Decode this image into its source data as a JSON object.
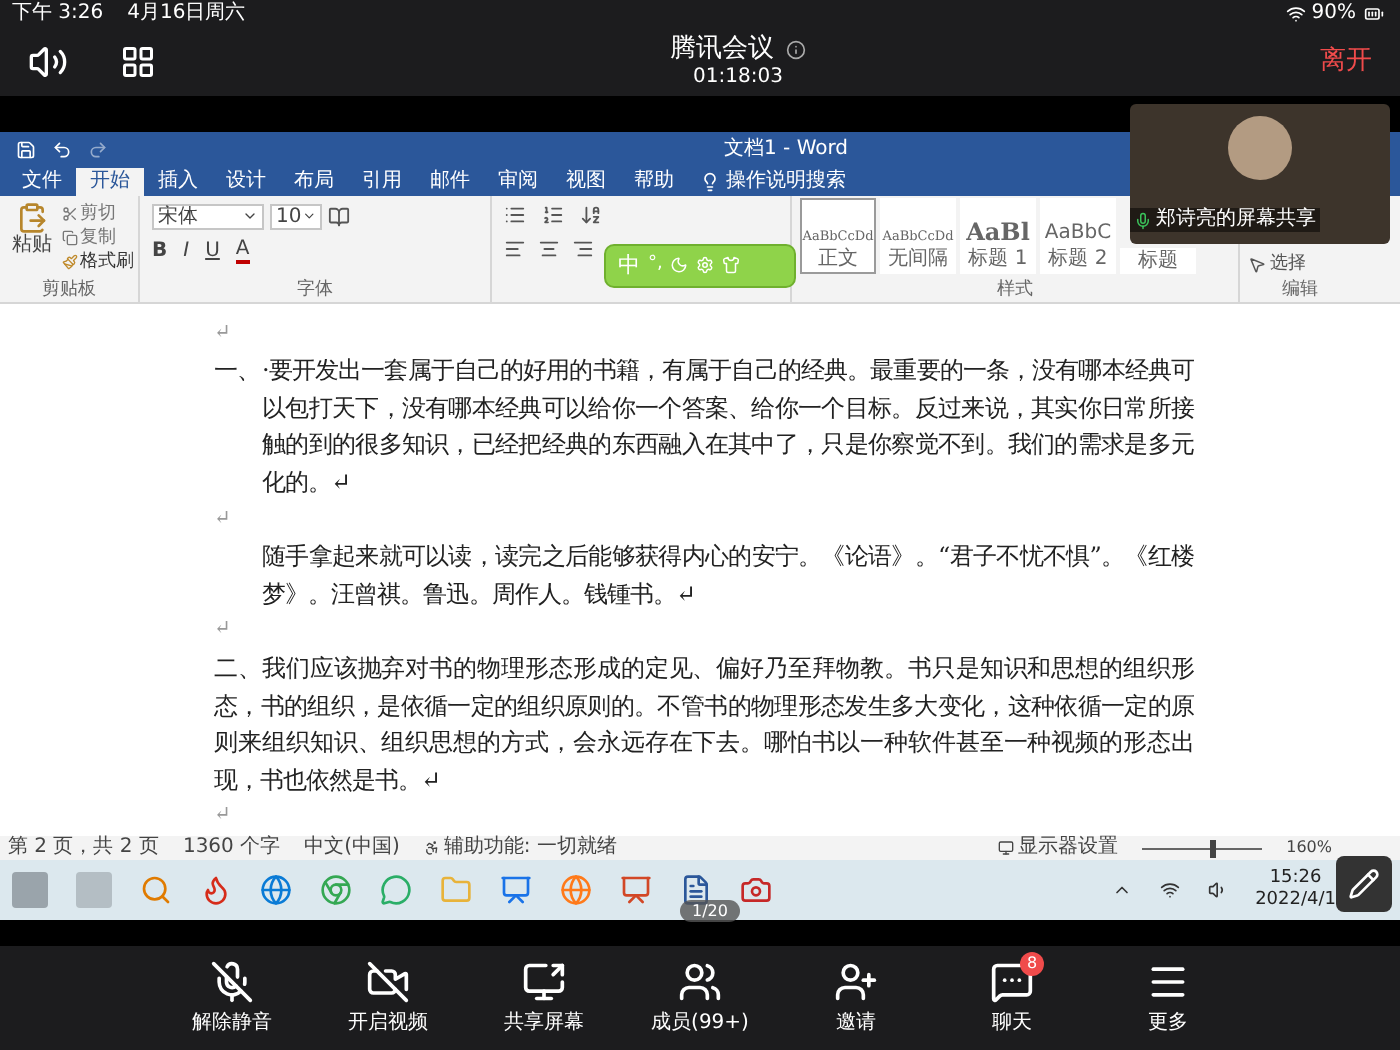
{
  "status_bar": {
    "time": "下午 3:26",
    "date": "4月16日周六",
    "battery": "90%"
  },
  "meeting_bar": {
    "title": "腾讯会议",
    "duration": "01:18:03",
    "leave": "离开"
  },
  "word": {
    "title": "文档1 - Word",
    "tabs": [
      {
        "label": "文件",
        "selected": false
      },
      {
        "label": "开始",
        "selected": true
      },
      {
        "label": "插入",
        "selected": false
      },
      {
        "label": "设计",
        "selected": false
      },
      {
        "label": "布局",
        "selected": false
      },
      {
        "label": "引用",
        "selected": false
      },
      {
        "label": "邮件",
        "selected": false
      },
      {
        "label": "审阅",
        "selected": false
      },
      {
        "label": "视图",
        "selected": false
      },
      {
        "label": "帮助",
        "selected": false
      }
    ],
    "tell_me": "操作说明搜索",
    "clipboard": {
      "paste": "粘贴",
      "cut": "剪切",
      "copy": "复制",
      "format_painter": "格式刷",
      "group": "剪贴板"
    },
    "font": {
      "name": "宋体",
      "size": "10",
      "group": "字体",
      "buttons": [
        {
          "kind": "bold",
          "label": "B"
        },
        {
          "kind": "italic",
          "label": "I"
        },
        {
          "kind": "underline",
          "label": "U"
        },
        {
          "kind": "color",
          "label": "A"
        }
      ]
    },
    "ime_bar": {
      "mode": "中",
      "punct": "°,"
    },
    "styles": {
      "group": "样式",
      "items": [
        {
          "kind": "body",
          "sample": "AaBbCcDd",
          "label": "正文",
          "selected": true
        },
        {
          "kind": "body",
          "sample": "AaBbCcDd",
          "label": "无间隔",
          "selected": false
        },
        {
          "kind": "heading1",
          "sample": "AaBl",
          "label": "标题 1",
          "selected": false
        },
        {
          "kind": "heading2",
          "sample": "AaBbC",
          "label": "标题 2",
          "selected": false
        },
        {
          "kind": "title",
          "label": "标题",
          "selected": false
        }
      ]
    },
    "editing": {
      "select": "选择",
      "group": "编辑"
    },
    "document": {
      "paragraphs": [
        {
          "kind": "empty",
          "text": "↵"
        },
        {
          "kind": "hanging",
          "label": "一、",
          "text": "·要开发出一套属于自己的好用的书籍，有属于自己的经典。最重要的一条，没有哪本经典可以包打天下，没有哪本经典可以给你一个答案、给你一个目标。反过来说，其实你日常所接触的到的很多知识，已经把经典的东西融入在其中了，只是你察觉不到。我们的需求是多元化的。↵"
        },
        {
          "kind": "empty",
          "text": "↵"
        },
        {
          "kind": "indented",
          "text": "随手拿起来就可以读，读完之后能够获得内心的安宁。《论语》。“君子不忧不惧”。《红楼梦》。汪曾祺。鲁迅。周作人。钱锺书。↵"
        },
        {
          "kind": "empty",
          "text": "↵"
        },
        {
          "kind": "plain",
          "text": "二、我们应该抛弃对书的物理形态形成的定见、偏好乃至拜物教。书只是知识和思想的组织形态，书的组织，是依循一定的组织原则的。不管书的物理形态发生多大变化，这种依循一定的原则来组织知识、组织思想的方式，会永远存在下去。哪怕书以一种软件甚至一种视频的形态出现，书也依然是书。↵"
        },
        {
          "kind": "empty",
          "text": "↵"
        }
      ]
    },
    "status": {
      "page": "第 2 页，共 2 页",
      "words": "1360 个字",
      "language": "中文(中国)",
      "accessibility": "辅助功能: 一切就绪",
      "display": "显示器设置",
      "zoom": "160%",
      "zoom_slider": {
        "level": 0.6
      }
    }
  },
  "taskbar": {
    "time": "15:26",
    "date": "2022/4/1",
    "page_indicator": "1/20"
  },
  "video_tile": {
    "name": "郑诗亮的屏幕共享"
  },
  "toolbar": [
    {
      "kind": "mic_off",
      "label": "解除静音"
    },
    {
      "kind": "video_off",
      "label": "开启视频"
    },
    {
      "kind": "share",
      "label": "共享屏幕"
    },
    {
      "kind": "members",
      "label": "成员(99+)"
    },
    {
      "kind": "invite",
      "label": "邀请"
    },
    {
      "kind": "chat",
      "label": "聊天",
      "badge": "8"
    },
    {
      "kind": "more",
      "label": "更多"
    }
  ]
}
